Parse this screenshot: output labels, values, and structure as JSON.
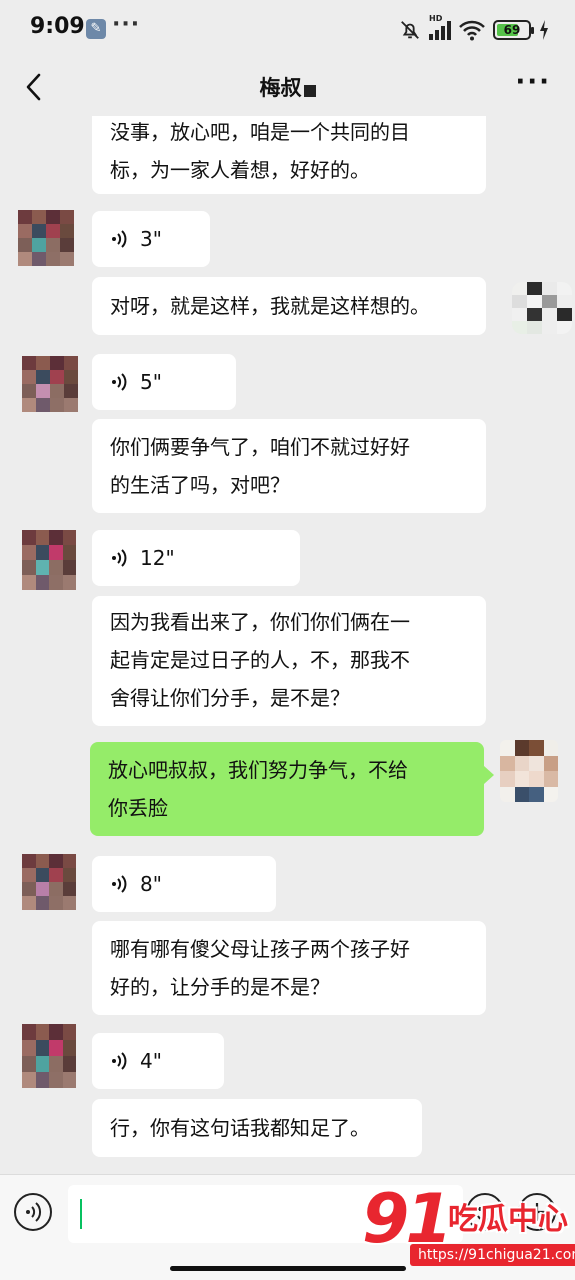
{
  "status_bar": {
    "time": "9:09",
    "more": "···",
    "battery": "69"
  },
  "nav": {
    "title": "梅叔"
  },
  "messages": [
    {
      "type": "text",
      "lines": [
        "没事，放心吧，咱是一个共同的目",
        "标，为一家人着想，好好的。"
      ]
    },
    {
      "type": "voice",
      "duration": "3\""
    },
    {
      "type": "text",
      "lines": [
        "对呀，就是这样，我就是这样想的。"
      ]
    },
    {
      "type": "voice",
      "duration": "5\""
    },
    {
      "type": "text",
      "lines": [
        "你们俩要争气了，咱们不就过好好",
        "的生活了吗，对吧？"
      ]
    },
    {
      "type": "voice",
      "duration": "12\""
    },
    {
      "type": "text",
      "lines": [
        "因为我看出来了，你们你们俩在一",
        "起肯定是过日子的人，不，那我不",
        "舍得让你们分手，是不是？"
      ]
    },
    {
      "type": "text",
      "sender": "me",
      "lines": [
        "放心吧叔叔，我们努力争气，不给",
        "你丢脸"
      ]
    },
    {
      "type": "voice",
      "duration": "8\""
    },
    {
      "type": "text",
      "lines": [
        "哪有哪有傻父母让孩子两个孩子好",
        "好的，让分手的是不是？"
      ]
    },
    {
      "type": "voice",
      "duration": "4\""
    },
    {
      "type": "text",
      "lines": [
        "行，你有这句话我都知足了。"
      ]
    }
  ],
  "watermark": {
    "number": "91",
    "text": "吃瓜中心",
    "url": "https://91chigua21.com"
  },
  "colors": {
    "background": "#ededed",
    "bubble_other": "#ffffff",
    "bubble_me": "#95ec69",
    "accent": "#07c160",
    "watermark": "#e8262f"
  },
  "icons": [
    "back-arrow-icon",
    "more-icon",
    "voice-wave-icon",
    "voice-input-icon",
    "emoji-icon",
    "plus-icon",
    "mute-bell-icon",
    "signal-icon",
    "wifi-icon",
    "battery-icon",
    "wrench-icon"
  ]
}
